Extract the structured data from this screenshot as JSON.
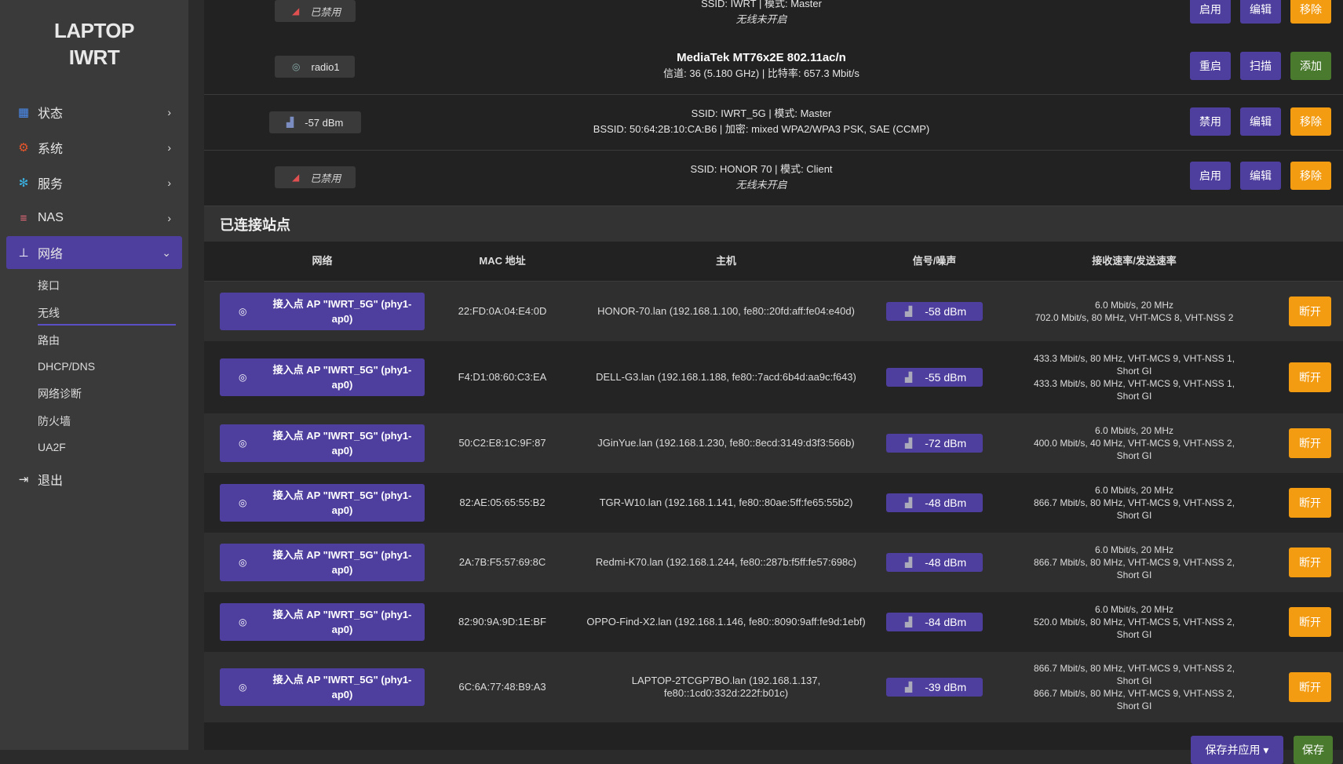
{
  "brand": "LAPTOP\nIWRT",
  "nav": [
    {
      "label": "状态",
      "icon": "dashboard-icon"
    },
    {
      "label": "系统",
      "icon": "gear-icon"
    },
    {
      "label": "服务",
      "icon": "cogs-icon"
    },
    {
      "label": "NAS",
      "icon": "database-icon"
    },
    {
      "label": "网络",
      "icon": "sitemap-icon"
    }
  ],
  "subnav": [
    "接口",
    "无线",
    "路由",
    "DHCP/DNS",
    "网络诊断",
    "防火墙",
    "UA2F"
  ],
  "logout": "退出",
  "devices": [
    {
      "chip": "已禁用",
      "line1": "SSID: IWRT | 模式: Master",
      "line2": "无线未开启",
      "btn1": "启用",
      "btn2": "编辑",
      "btn3": "移除"
    },
    {
      "chip": "radio1",
      "title": "MediaTek MT76x2E 802.11ac/n",
      "line2": "信道: 36 (5.180 GHz) | 比特率: 657.3 Mbit/s",
      "btn1": "重启",
      "btn2": "扫描",
      "btn3": "添加"
    },
    {
      "chip": "-57 dBm",
      "line1": "SSID: IWRT_5G | 模式: Master",
      "line2": "BSSID: 50:64:2B:10:CA:B6 | 加密: mixed WPA2/WPA3 PSK, SAE (CCMP)",
      "btn1": "禁用",
      "btn2": "编辑",
      "btn3": "移除"
    },
    {
      "chip": "已禁用",
      "line1": "SSID: HONOR 70 | 模式: Client",
      "line2": "无线未开启",
      "btn1": "启用",
      "btn2": "编辑",
      "btn3": "移除"
    }
  ],
  "section_title": "已连接站点",
  "headers": [
    "网络",
    "MAC 地址",
    "主机",
    "信号/噪声",
    "接收速率/发送速率"
  ],
  "network_label": "接入点 AP \"IWRT_5G\" (phy1-ap0)",
  "disconnect_label": "断开",
  "stations": [
    {
      "mac": "22:FD:0A:04:E4:0D",
      "host": "HONOR-70.lan (192.168.1.100, fe80::20fd:aff:fe04:e40d)",
      "signal": "-58 dBm",
      "rate": "6.0 Mbit/s, 20 MHz\n702.0 Mbit/s, 80 MHz, VHT-MCS 8, VHT-NSS 2"
    },
    {
      "mac": "F4:D1:08:60:C3:EA",
      "host": "DELL-G3.lan (192.168.1.188, fe80::7acd:6b4d:aa9c:f643)",
      "signal": "-55 dBm",
      "rate": "433.3 Mbit/s, 80 MHz, VHT-MCS 9, VHT-NSS 1,\nShort GI\n433.3 Mbit/s, 80 MHz, VHT-MCS 9, VHT-NSS 1,\nShort GI"
    },
    {
      "mac": "50:C2:E8:1C:9F:87",
      "host": "JGinYue.lan (192.168.1.230, fe80::8ecd:3149:d3f3:566b)",
      "signal": "-72 dBm",
      "rate": "6.0 Mbit/s, 20 MHz\n400.0 Mbit/s, 40 MHz, VHT-MCS 9, VHT-NSS 2,\nShort GI"
    },
    {
      "mac": "82:AE:05:65:55:B2",
      "host": "TGR-W10.lan (192.168.1.141, fe80::80ae:5ff:fe65:55b2)",
      "signal": "-48 dBm",
      "rate": "6.0 Mbit/s, 20 MHz\n866.7 Mbit/s, 80 MHz, VHT-MCS 9, VHT-NSS 2,\nShort GI"
    },
    {
      "mac": "2A:7B:F5:57:69:8C",
      "host": "Redmi-K70.lan (192.168.1.244, fe80::287b:f5ff:fe57:698c)",
      "signal": "-48 dBm",
      "rate": "6.0 Mbit/s, 20 MHz\n866.7 Mbit/s, 80 MHz, VHT-MCS 9, VHT-NSS 2,\nShort GI"
    },
    {
      "mac": "82:90:9A:9D:1E:BF",
      "host": "OPPO-Find-X2.lan (192.168.1.146, fe80::8090:9aff:fe9d:1ebf)",
      "signal": "-84 dBm",
      "rate": "6.0 Mbit/s, 20 MHz\n520.0 Mbit/s, 80 MHz, VHT-MCS 5, VHT-NSS 2,\nShort GI"
    },
    {
      "mac": "6C:6A:77:48:B9:A3",
      "host": "LAPTOP-2TCGP7BO.lan (192.168.1.137,\nfe80::1cd0:332d:222f:b01c)",
      "signal": "-39 dBm",
      "rate": "866.7 Mbit/s, 80 MHz, VHT-MCS 9, VHT-NSS 2,\nShort GI\n866.7 Mbit/s, 80 MHz, VHT-MCS 9, VHT-NSS 2,\nShort GI"
    }
  ],
  "footer": {
    "save_apply": "保存并应用 ▾",
    "save": "保存"
  }
}
